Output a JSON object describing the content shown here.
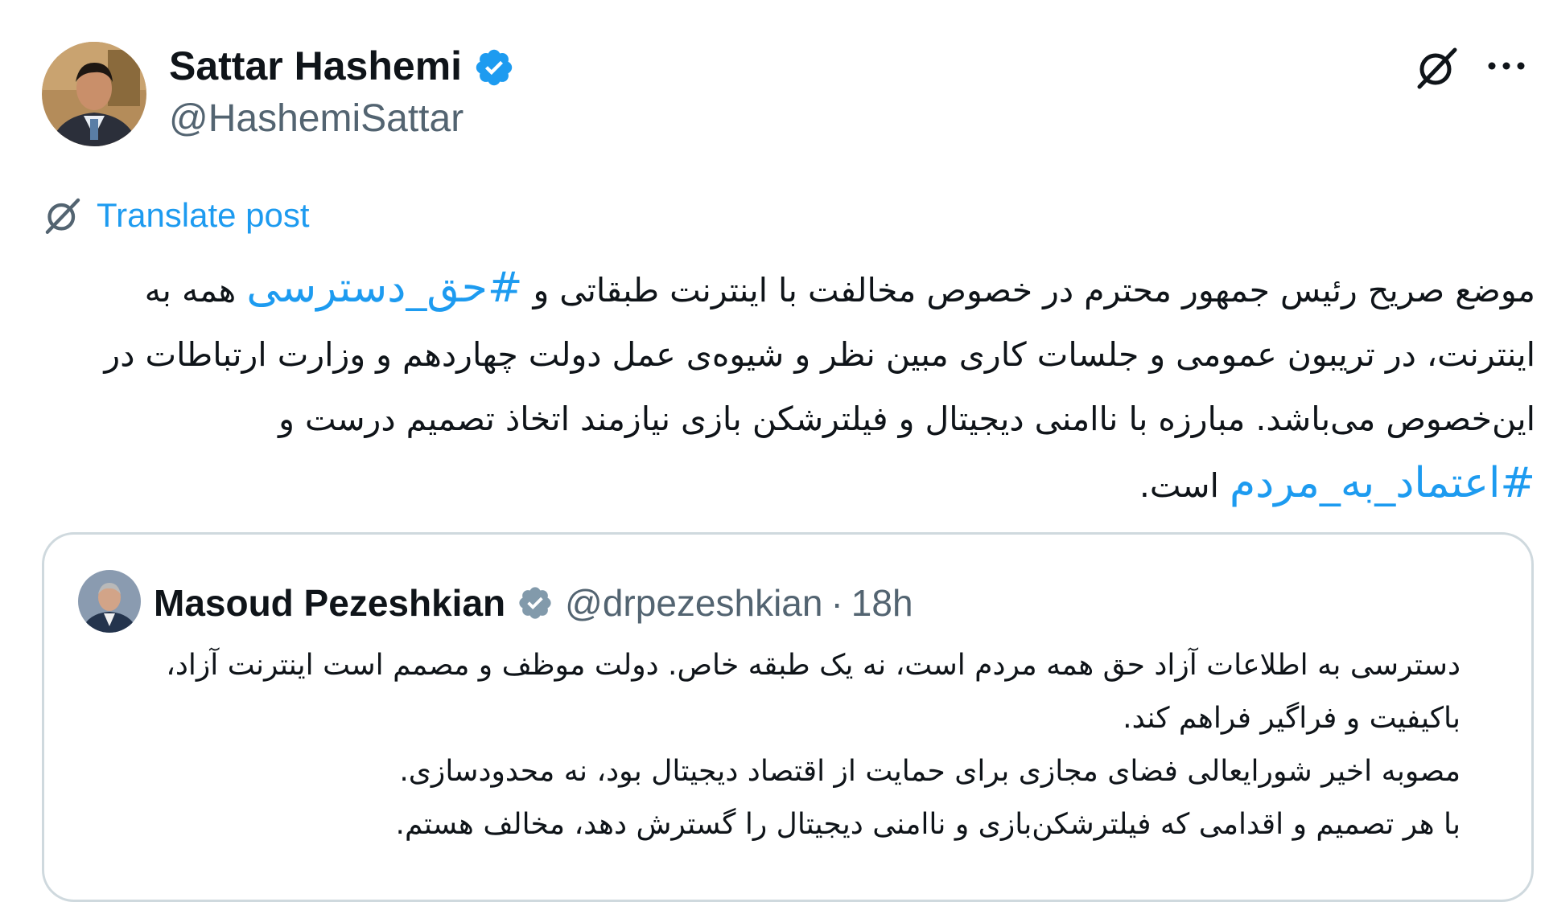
{
  "post": {
    "author_name": "Sattar Hashemi",
    "author_handle": "@HashemiSattar",
    "translate_label": "Translate post",
    "text": {
      "part1": "موضع صریح رئیس جمهور محترم در خصوص مخالفت با اینترنت طبقاتی و ",
      "hashtag1": "#حق_دسترسی",
      "part2": " همه به اینترنت، در تریبون عمومی و جلسات کاری مبین نظر و شیوه‌ی عمل دولت چهاردهم و وزارت ارتباطات در این‌خصوص می‌باشد. مبارزه با ناامنی دیجیتال و فیلترشکن بازی نیازمند اتخاذ تصمیم درست و ",
      "hashtag2": "#اعتماد_به_مردم",
      "part3": " است."
    }
  },
  "quoted": {
    "author_name": "Masoud Pezeshkian",
    "author_handle": "@drpezeshkian",
    "separator": "·",
    "time": "18h",
    "lines": [
      "دسترسی به اطلاعات آزاد حق همه مردم است، نه یک طبقه خاص. دولت موظف و مصمم است اینترنت آزاد،",
      "باکیفیت و فراگیر فراهم کند.",
      "مصوبه اخیر شورایعالی فضای مجازی برای حمایت از اقتصاد دیجیتال بود، نه محدودسازی.",
      "با هر تصمیم و اقدامی که فیلترشکن‌بازی و ناامنی دیجیتال را گسترش دهد، مخالف هستم."
    ]
  },
  "icons": {
    "verified_main": "verified-blue-badge-icon",
    "verified_quoted": "verified-gray-badge-icon",
    "grok": "grok-icon",
    "more": "more-icon",
    "translate": "translate-icon"
  },
  "colors": {
    "link": "#1d9bf0",
    "secondary_text": "#536471",
    "border": "#cfd9de",
    "verified_blue": "#1d9bf0",
    "verified_gray": "#829aab"
  }
}
